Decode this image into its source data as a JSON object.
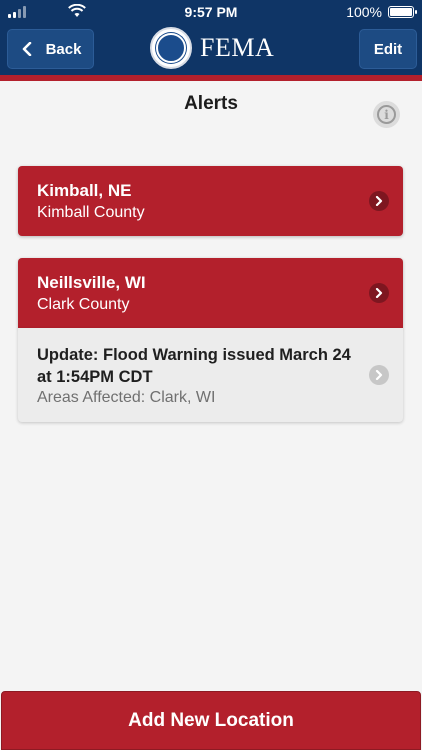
{
  "status_bar": {
    "time": "9:57 PM",
    "battery": "100%"
  },
  "nav": {
    "back_label": "Back",
    "edit_label": "Edit",
    "logo_text": "FEMA"
  },
  "page": {
    "title": "Alerts"
  },
  "locations": [
    {
      "city": "Kimball, NE",
      "county": "Kimball County"
    },
    {
      "city": "Neillsville, WI",
      "county": "Clark County"
    }
  ],
  "update": {
    "title": "Update: Flood Warning issued March 24 at 1:54PM CDT",
    "areas": "Areas Affected: Clark, WI"
  },
  "footer": {
    "add_label": "Add New Location"
  },
  "colors": {
    "navy": "#0f3566",
    "red": "#b3202c",
    "background": "#f4f4f4"
  },
  "icons": {
    "back": "chevron-left-icon",
    "row_nav": "chevron-right-icon",
    "info": "info-icon",
    "logo": "dhs-seal-icon"
  }
}
